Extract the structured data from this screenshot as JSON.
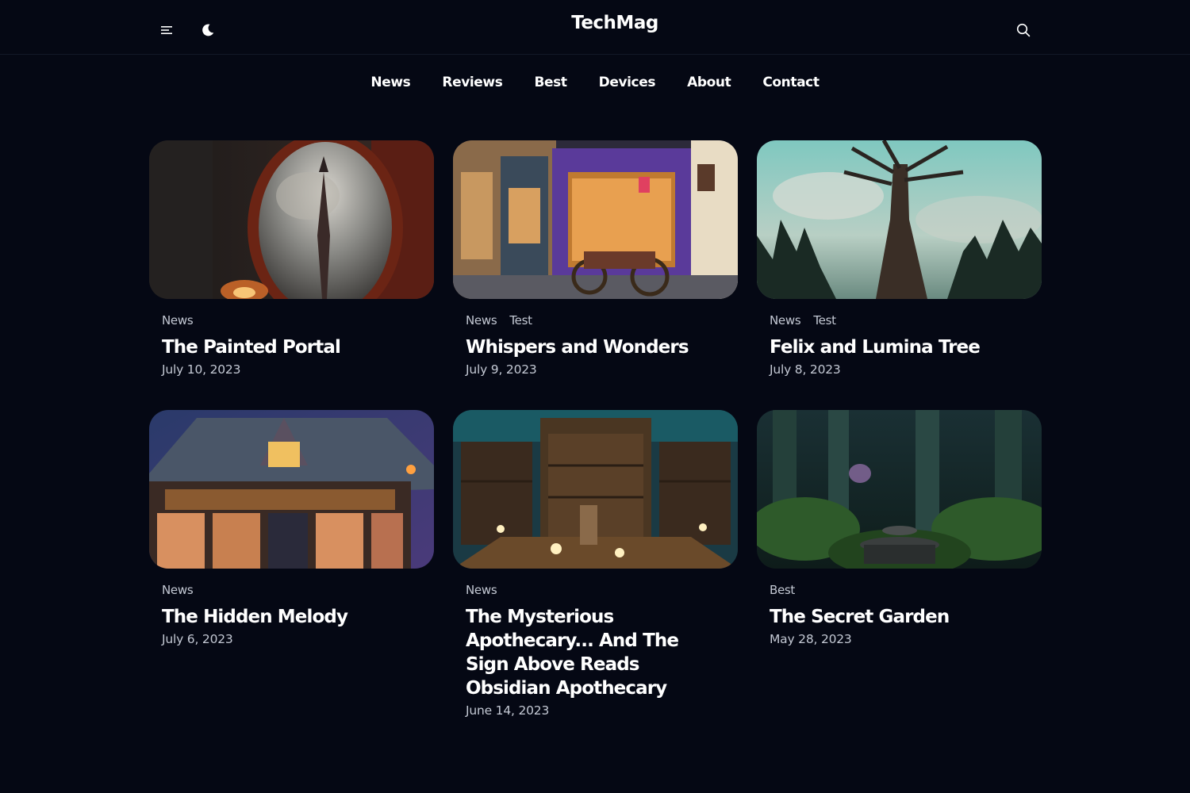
{
  "header": {
    "logo": "TechMag",
    "icons": [
      "menu-icon",
      "moon-icon",
      "search-icon"
    ]
  },
  "nav": {
    "items": [
      "News",
      "Reviews",
      "Best",
      "Devices",
      "About",
      "Contact"
    ]
  },
  "posts": [
    {
      "tags": [
        "News"
      ],
      "title": "The Painted Portal",
      "date": "July 10, 2023"
    },
    {
      "tags": [
        "News",
        "Test"
      ],
      "title": "Whispers and Wonders",
      "date": "July 9, 2023"
    },
    {
      "tags": [
        "News",
        "Test"
      ],
      "title": "Felix and Lumina Tree",
      "date": "July 8, 2023"
    },
    {
      "tags": [
        "News"
      ],
      "title": "The Hidden Melody",
      "date": "July 6, 2023"
    },
    {
      "tags": [
        "News"
      ],
      "title": "The Mysterious Apothecary... And The Sign Above Reads Obsidian Apothecary",
      "date": "June 14, 2023"
    },
    {
      "tags": [
        "Best"
      ],
      "title": "The Secret Garden",
      "date": "May 28, 2023"
    }
  ],
  "colors": {
    "background": "#050814",
    "text": "#ffffff",
    "muted": "#c4c9d4"
  }
}
